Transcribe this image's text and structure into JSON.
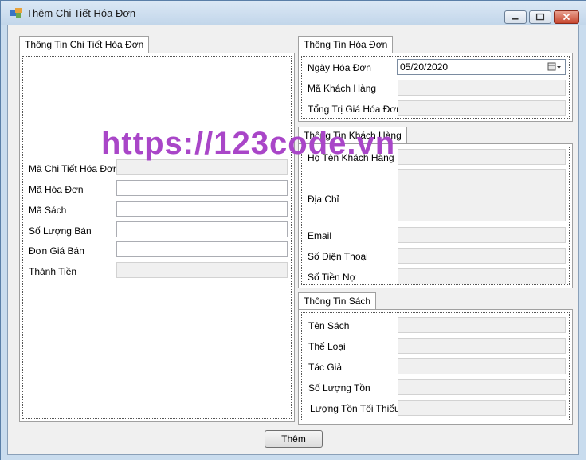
{
  "window": {
    "title": "Thêm Chi Tiết Hóa Đơn"
  },
  "chi_tiet": {
    "tab": "Thông Tin Chi Tiết Hóa Đơn",
    "fields": [
      {
        "label": "Mã Chi Tiết Hóa Đơn",
        "value": "",
        "readonly": true
      },
      {
        "label": "Mã Hóa Đơn",
        "value": "",
        "readonly": false
      },
      {
        "label": "Mã Sách",
        "value": "",
        "readonly": false
      },
      {
        "label": "Số Lượng Bán",
        "value": "",
        "readonly": false
      },
      {
        "label": "Đơn Giá Bán",
        "value": "",
        "readonly": false
      },
      {
        "label": "Thành Tiền",
        "value": "",
        "readonly": true
      }
    ]
  },
  "hoa_don": {
    "tab": "Thông Tin Hóa Đơn",
    "ngay_label": "Ngày Hóa Đơn",
    "ngay_value": "05/20/2020",
    "ma_kh_label": "Mã Khách Hàng",
    "tong_label": "Tổng Trị Giá Hóa Đơn"
  },
  "khach_hang": {
    "tab": "Thông Tin Khách Hàng",
    "ho_ten_label": "Họ Tên Khách Hàng",
    "dia_chi_label": "Địa Chỉ",
    "email_label": "Email",
    "sdt_label": "Số Điện Thoại",
    "no_label": "Số Tiền Nợ"
  },
  "sach": {
    "tab": "Thông Tin Sách",
    "ten_label": "Tên Sách",
    "the_loai_label": "Thể Loại",
    "tac_gia_label": "Tác Giả",
    "ton_label": "Số Lượng Tồn",
    "ton_min_label": "Lượng Tồn Tối Thiểu"
  },
  "actions": {
    "add_label": "Thêm"
  },
  "watermark": "https://123code.vn",
  "colors": {
    "title_bar": "#c9dcee",
    "watermark": "#a946c8",
    "close_button": "#c7462e"
  }
}
